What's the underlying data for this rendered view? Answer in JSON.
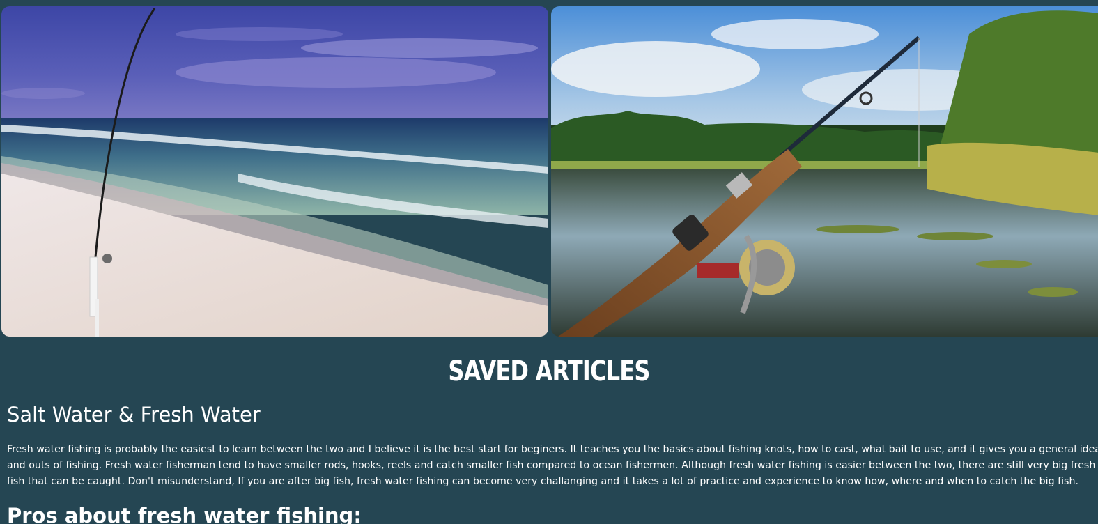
{
  "images": [
    {
      "name": "beach-fishing-photo",
      "alt": "Fishing rod on a sandy beach with ocean waves"
    },
    {
      "name": "lake-fishing-photo",
      "alt": "Fishing rod and spinning reel over a calm lake"
    }
  ],
  "section_title": "SAVED ARTICLES",
  "article": {
    "heading": "Salt Water & Fresh Water",
    "body_lines": [
      "Fresh water fishing is probably the easiest to learn between the two and I believe it is the best start for beginers. It teaches you the basics about fishing knots, how to cast, what bait to use, and it gives you a general idea of the ins",
      "and outs of fishing. Fresh water fisherman tend to have smaller rods, hooks, reels and catch smaller fish compared to ocean fishermen. Although fresh water fishing is easier between the two, there are still very big fresh water",
      "fish that can be caught. Don't misunderstand, If you are after big fish, fresh water fishing can become very challanging and it takes a lot of practice and experience to know how, where and when to catch the big fish."
    ],
    "pros_heading": "Pros about fresh water fishing:"
  },
  "colors": {
    "background": "#254653",
    "text": "#ffffff"
  }
}
